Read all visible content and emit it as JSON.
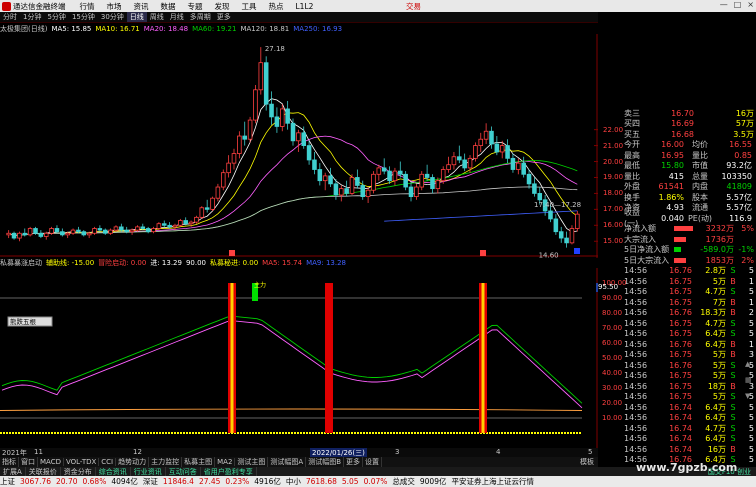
{
  "titlebar": {
    "app_name": "通达信金融终端",
    "menus": [
      "行情",
      "市场",
      "资讯",
      "数据",
      "专题",
      "发现",
      "工具",
      "热点",
      "L1L2"
    ],
    "trade": "交易",
    "win_buttons": [
      "—",
      "□",
      "×"
    ]
  },
  "periods": [
    "分时",
    "1分钟",
    "5分钟",
    "15分钟",
    "30分钟",
    "日线",
    "周线",
    "月线",
    "多周期",
    "更多"
  ],
  "selected_period": "日线",
  "main_indicator": {
    "stock": "太极集团(日线)",
    "items": [
      {
        "text": "MA5: 15.85",
        "color": "#ffffff"
      },
      {
        "text": "MA10: 16.71",
        "color": "#ffff00"
      },
      {
        "text": "MA20: 18.48",
        "color": "#ff60ff"
      },
      {
        "text": "MA60: 19.21",
        "color": "#00d000"
      },
      {
        "text": "MA120: 18.81",
        "color": "#c8c8c8"
      },
      {
        "text": "MA250: 16.93",
        "color": "#4060ff"
      }
    ]
  },
  "sub_indicator": {
    "items": [
      {
        "text": "私募暴涨启动",
        "color": "#c8c8c8"
      },
      {
        "text": "辅助线: -15.00",
        "color": "#ffff00"
      },
      {
        "text": "冒险启动: 0.00",
        "color": "#ff4040"
      },
      {
        "text": "进: 13.29",
        "color": "#ffffff"
      },
      {
        "text": "90.00",
        "color": "#ffffff"
      },
      {
        "text": "私募秘进: 0.00",
        "color": "#ffff00"
      },
      {
        "text": "MA5: 15.74",
        "color": "#ff4040"
      },
      {
        "text": "MA9: 13.28",
        "color": "#4060ff"
      }
    ]
  },
  "chart_labels": {
    "high": "27.18",
    "low": "14.60",
    "mid_mark": "17.40—17.28",
    "signal_label": "主力",
    "bubble_label": "熊跌五根",
    "sub_left_value": "95.50"
  },
  "price_axis": [
    "22.00",
    "21.00",
    "20.00",
    "19.00",
    "18.00",
    "17.00",
    "16.00",
    "15.00"
  ],
  "sub_axis": [
    "100.00",
    "90.00",
    "80.00",
    "70.00",
    "60.00",
    "50.00",
    "40.00",
    "30.00",
    "20.00",
    "10.00"
  ],
  "quote": {
    "asks": [
      {
        "label": "卖三",
        "price": "16.70",
        "vol": "16万"
      },
      {
        "label": "买四",
        "price": "16.69",
        "vol": "57万"
      },
      {
        "label": "买五",
        "price": "16.68",
        "vol": "3.5万"
      }
    ],
    "stats": [
      {
        "l1": "今开",
        "v1": "16.00",
        "c1": "up",
        "l2": "均价",
        "v2": "16.55",
        "c2": "up"
      },
      {
        "l1": "最高",
        "v1": "16.95",
        "c1": "up",
        "l2": "量比",
        "v2": "0.85",
        "c2": "up"
      },
      {
        "l1": "最低",
        "v1": "15.80",
        "c1": "dn",
        "l2": "市值",
        "v2": "93.2亿",
        "c2": "wht"
      },
      {
        "l1": "量比",
        "v1": "415",
        "c1": "wht",
        "l2": "总量",
        "v2": "103350",
        "c2": "wht"
      },
      {
        "l1": "外盘",
        "v1": "61541",
        "c1": "up",
        "l2": "内盘",
        "v2": "41809",
        "c2": "dn"
      },
      {
        "l1": "换手",
        "v1": "1.86%",
        "c1": "yel",
        "l2": "股本",
        "v2": "5.57亿",
        "c2": "wht"
      },
      {
        "l1": "净资",
        "v1": "4.93",
        "c1": "wht",
        "l2": "流通",
        "v2": "5.57亿",
        "c2": "wht"
      },
      {
        "l1": "收益(一)",
        "v1": "0.040",
        "c1": "wht",
        "l2": "PE(动)",
        "v2": "116.9",
        "c2": "wht"
      }
    ],
    "flows": [
      {
        "label": "净流入额",
        "value": "3232万",
        "pct": "5%",
        "color": "#ff4040",
        "fill": 0.8
      },
      {
        "label": "大宗流入",
        "value": "1736万",
        "pct": "",
        "color": "#ff4040",
        "fill": 0.5
      },
      {
        "label": "5日净流入额",
        "value": "-589.0万",
        "pct": "-1%",
        "color": "#00d000",
        "fill": 0.3
      },
      {
        "label": "5日大宗流入",
        "value": "1853万",
        "pct": "2%",
        "color": "#ff4040",
        "fill": 0.5
      }
    ],
    "ticks": [
      {
        "t": "14:56",
        "p": "16.76",
        "v": "2.8万",
        "d": "S",
        "n": "5"
      },
      {
        "t": "14:56",
        "p": "16.75",
        "v": "5万",
        "d": "B",
        "n": "1"
      },
      {
        "t": "14:56",
        "p": "16.75",
        "v": "4.7万",
        "d": "S",
        "n": "5"
      },
      {
        "t": "14:56",
        "p": "16.75",
        "v": "7万",
        "d": "B",
        "n": "1"
      },
      {
        "t": "14:56",
        "p": "16.76",
        "v": "18.3万",
        "d": "B",
        "n": "2"
      },
      {
        "t": "14:56",
        "p": "16.75",
        "v": "4.7万",
        "d": "S",
        "n": "5"
      },
      {
        "t": "14:56",
        "p": "16.75",
        "v": "6.4万",
        "d": "S",
        "n": "5"
      },
      {
        "t": "14:56",
        "p": "16.76",
        "v": "6.4万",
        "d": "B",
        "n": "1"
      },
      {
        "t": "14:56",
        "p": "16.75",
        "v": "5万",
        "d": "B",
        "n": "3"
      },
      {
        "t": "14:56",
        "p": "16.76",
        "v": "5万",
        "d": "S",
        "n": "5"
      },
      {
        "t": "14:56",
        "p": "16.75",
        "v": "5万",
        "d": "S",
        "n": "5"
      },
      {
        "t": "14:56",
        "p": "16.75",
        "v": "18万",
        "d": "B",
        "n": "3"
      },
      {
        "t": "14:56",
        "p": "16.75",
        "v": "5万",
        "d": "S",
        "n": "5"
      },
      {
        "t": "14:56",
        "p": "16.74",
        "v": "6.4万",
        "d": "S",
        "n": "5"
      },
      {
        "t": "14:56",
        "p": "16.74",
        "v": "6.4万",
        "d": "S",
        "n": "5"
      },
      {
        "t": "14:56",
        "p": "16.74",
        "v": "4.7万",
        "d": "S",
        "n": "5"
      },
      {
        "t": "14:56",
        "p": "16.74",
        "v": "6.4万",
        "d": "S",
        "n": "5"
      },
      {
        "t": "14:56",
        "p": "16.74",
        "v": "16万",
        "d": "B",
        "n": "5"
      },
      {
        "t": "14:56",
        "p": "16.76",
        "v": "6.4万",
        "d": "S",
        "n": "5"
      }
    ]
  },
  "datebar": {
    "labels": [
      {
        "text": "2021年",
        "pos": 2
      },
      {
        "text": "11",
        "pos": 34
      },
      {
        "text": "12",
        "pos": 133
      },
      {
        "text": "2022/01/26(三)",
        "pos": 310,
        "cur": true
      },
      {
        "text": "3",
        "pos": 395
      },
      {
        "text": "4",
        "pos": 496
      },
      {
        "text": "5",
        "pos": 588
      }
    ]
  },
  "tabs": [
    "指标",
    "窗口",
    "MACD",
    "VOL-TDX",
    "CCI",
    "趋势动力",
    "主力监控",
    "私募主图",
    "MA2",
    "测试主图",
    "测试幅图A",
    "测试幅图B",
    "更多",
    "设置"
  ],
  "tabbar_right": "模板",
  "toolbar2": [
    "扩展A",
    "关联报价",
    "资金分布",
    "综合资讯",
    "行业资讯",
    "互动问答",
    "省用户盈利专享"
  ],
  "toolbar2_right": "国交F10 创业",
  "statusbar": [
    {
      "text": "上证",
      "cls": ""
    },
    {
      "text": "3067.76",
      "cls": "sb-up"
    },
    {
      "text": "20.70",
      "cls": "sb-up"
    },
    {
      "text": "0.68%",
      "cls": "sb-up"
    },
    {
      "text": "4094亿",
      "cls": ""
    },
    {
      "text": "深证",
      "cls": ""
    },
    {
      "text": "11846.4",
      "cls": "sb-up"
    },
    {
      "text": "27.45",
      "cls": "sb-up"
    },
    {
      "text": "0.23%",
      "cls": "sb-up"
    },
    {
      "text": "4916亿",
      "cls": ""
    },
    {
      "text": "中小",
      "cls": ""
    },
    {
      "text": "7618.68",
      "cls": "sb-up"
    },
    {
      "text": "5.05",
      "cls": "sb-up"
    },
    {
      "text": "0.07%",
      "cls": "sb-up"
    },
    {
      "text": "总成交",
      "cls": ""
    },
    {
      "text": "9009亿",
      "cls": ""
    },
    {
      "text": "平安证券上海上证云行情",
      "cls": ""
    }
  ],
  "watermark": "www.7gpzb.com",
  "colors": {
    "up": "#ff4040",
    "down": "#40d0d0",
    "ma5": "#ffffff",
    "ma10": "#ffff00",
    "ma20": "#ff60ff",
    "ma60": "#00d000",
    "ma120": "#c8c8c8",
    "ma250": "#4060ff"
  },
  "chart_data": {
    "type": "candlestick",
    "note_units": "price in CNY",
    "candles": [
      [
        15.4,
        15.7,
        15.2,
        15.5
      ],
      [
        15.5,
        15.6,
        15.1,
        15.2
      ],
      [
        15.2,
        15.6,
        15.0,
        15.5
      ],
      [
        15.5,
        15.8,
        15.3,
        15.4
      ],
      [
        15.4,
        15.9,
        15.3,
        15.8
      ],
      [
        15.8,
        15.9,
        15.4,
        15.5
      ],
      [
        15.5,
        15.7,
        15.2,
        15.3
      ],
      [
        15.3,
        15.6,
        15.1,
        15.5
      ],
      [
        15.5,
        15.9,
        15.4,
        15.8
      ],
      [
        15.8,
        16.0,
        15.5,
        15.6
      ],
      [
        15.6,
        15.8,
        15.3,
        15.4
      ],
      [
        15.4,
        15.6,
        15.2,
        15.5
      ],
      [
        15.5,
        15.8,
        15.4,
        15.7
      ],
      [
        15.7,
        15.9,
        15.5,
        15.6
      ],
      [
        15.6,
        15.7,
        15.3,
        15.4
      ],
      [
        15.4,
        15.6,
        15.2,
        15.5
      ],
      [
        15.5,
        15.9,
        15.4,
        15.8
      ],
      [
        15.8,
        16.0,
        15.6,
        15.7
      ],
      [
        15.7,
        15.8,
        15.4,
        15.5
      ],
      [
        15.5,
        15.8,
        15.4,
        15.7
      ],
      [
        15.7,
        16.0,
        15.6,
        15.9
      ],
      [
        15.9,
        16.1,
        15.6,
        15.7
      ],
      [
        15.7,
        15.9,
        15.5,
        15.6
      ],
      [
        15.6,
        15.8,
        15.4,
        15.7
      ],
      [
        15.7,
        16.0,
        15.6,
        15.9
      ],
      [
        15.9,
        16.1,
        15.7,
        15.8
      ],
      [
        15.8,
        15.9,
        15.5,
        15.6
      ],
      [
        15.6,
        15.9,
        15.5,
        15.8
      ],
      [
        15.8,
        16.2,
        15.7,
        16.1
      ],
      [
        16.1,
        16.3,
        15.9,
        16.0
      ],
      [
        16.0,
        16.2,
        15.8,
        15.9
      ],
      [
        15.9,
        16.1,
        15.7,
        16.0
      ],
      [
        16.0,
        16.4,
        15.9,
        16.3
      ],
      [
        16.3,
        16.5,
        16.0,
        16.1
      ],
      [
        16.1,
        16.3,
        15.9,
        16.2
      ],
      [
        16.2,
        16.6,
        16.1,
        16.5
      ],
      [
        16.5,
        17.2,
        16.4,
        17.1
      ],
      [
        17.1,
        17.6,
        16.8,
        17.0
      ],
      [
        17.0,
        17.8,
        16.9,
        17.7
      ],
      [
        17.7,
        18.6,
        17.5,
        18.4
      ],
      [
        18.4,
        19.5,
        18.2,
        19.3
      ],
      [
        19.3,
        20.4,
        19.0,
        19.9
      ],
      [
        19.9,
        20.8,
        19.5,
        20.5
      ],
      [
        20.5,
        21.9,
        20.2,
        21.6
      ],
      [
        21.6,
        22.5,
        21.0,
        21.4
      ],
      [
        21.4,
        22.8,
        21.2,
        22.6
      ],
      [
        22.6,
        24.8,
        22.4,
        24.5
      ],
      [
        24.5,
        27.18,
        24.2,
        26.2
      ],
      [
        26.2,
        26.6,
        23.2,
        23.6
      ],
      [
        23.6,
        24.4,
        22.3,
        22.8
      ],
      [
        22.8,
        23.4,
        21.8,
        22.2
      ],
      [
        22.2,
        23.6,
        21.9,
        23.3
      ],
      [
        23.3,
        23.8,
        22.0,
        22.4
      ],
      [
        22.4,
        22.7,
        21.0,
        21.3
      ],
      [
        21.3,
        22.0,
        20.6,
        21.8
      ],
      [
        21.8,
        22.2,
        20.8,
        21.0
      ],
      [
        21.0,
        21.3,
        19.8,
        20.1
      ],
      [
        20.1,
        20.6,
        19.2,
        19.5
      ],
      [
        19.5,
        19.9,
        18.5,
        18.8
      ],
      [
        18.8,
        19.3,
        18.2,
        19.1
      ],
      [
        19.1,
        19.6,
        18.4,
        18.6
      ],
      [
        18.6,
        18.9,
        17.6,
        17.9
      ],
      [
        17.9,
        18.5,
        17.5,
        18.3
      ],
      [
        18.3,
        18.8,
        17.8,
        18.0
      ],
      [
        18.0,
        19.2,
        17.9,
        19.0
      ],
      [
        19.0,
        19.5,
        18.3,
        18.5
      ],
      [
        18.5,
        18.8,
        17.6,
        17.8
      ],
      [
        17.8,
        18.4,
        17.4,
        18.2
      ],
      [
        18.2,
        19.4,
        18.0,
        19.2
      ],
      [
        19.2,
        19.8,
        18.8,
        19.6
      ],
      [
        19.6,
        20.2,
        19.2,
        19.4
      ],
      [
        19.4,
        19.7,
        18.6,
        18.8
      ],
      [
        18.8,
        19.6,
        18.5,
        19.4
      ],
      [
        19.4,
        20.0,
        19.0,
        19.2
      ],
      [
        19.2,
        19.4,
        18.2,
        18.4
      ],
      [
        18.4,
        18.7,
        17.5,
        17.8
      ],
      [
        17.8,
        18.6,
        17.6,
        18.4
      ],
      [
        18.4,
        19.4,
        18.2,
        19.2
      ],
      [
        19.2,
        19.8,
        18.8,
        19.0
      ],
      [
        19.0,
        19.2,
        18.0,
        18.3
      ],
      [
        18.3,
        19.0,
        18.0,
        18.8
      ],
      [
        18.8,
        19.7,
        18.6,
        19.5
      ],
      [
        19.5,
        20.3,
        19.3,
        19.8
      ],
      [
        19.8,
        20.6,
        19.5,
        20.3
      ],
      [
        20.3,
        21.0,
        19.9,
        20.1
      ],
      [
        20.1,
        20.5,
        19.4,
        19.6
      ],
      [
        19.6,
        20.4,
        19.3,
        20.2
      ],
      [
        20.2,
        21.2,
        20.0,
        21.0
      ],
      [
        21.0,
        21.8,
        20.6,
        21.4
      ],
      [
        21.4,
        22.4,
        21.1,
        21.9
      ],
      [
        21.9,
        22.2,
        20.8,
        21.1
      ],
      [
        21.1,
        21.6,
        20.4,
        20.6
      ],
      [
        20.6,
        21.3,
        20.2,
        21.0
      ],
      [
        21.0,
        21.4,
        19.9,
        20.2
      ],
      [
        20.2,
        20.5,
        19.3,
        19.5
      ],
      [
        19.5,
        20.2,
        19.2,
        19.9
      ],
      [
        19.9,
        20.3,
        19.0,
        19.2
      ],
      [
        19.2,
        19.5,
        18.3,
        18.6
      ],
      [
        18.6,
        19.0,
        17.8,
        18.0
      ],
      [
        18.0,
        18.4,
        17.3,
        17.6
      ],
      [
        17.6,
        17.9,
        16.6,
        16.9
      ],
      [
        16.9,
        17.3,
        16.2,
        16.4
      ],
      [
        16.4,
        16.7,
        15.4,
        15.6
      ],
      [
        15.6,
        15.9,
        14.9,
        15.2
      ],
      [
        15.2,
        15.6,
        14.6,
        14.9
      ],
      [
        14.9,
        16.0,
        14.8,
        15.8
      ],
      [
        15.8,
        16.9,
        15.6,
        16.7
      ]
    ],
    "price_range": [
      14.2,
      28.0
    ]
  }
}
